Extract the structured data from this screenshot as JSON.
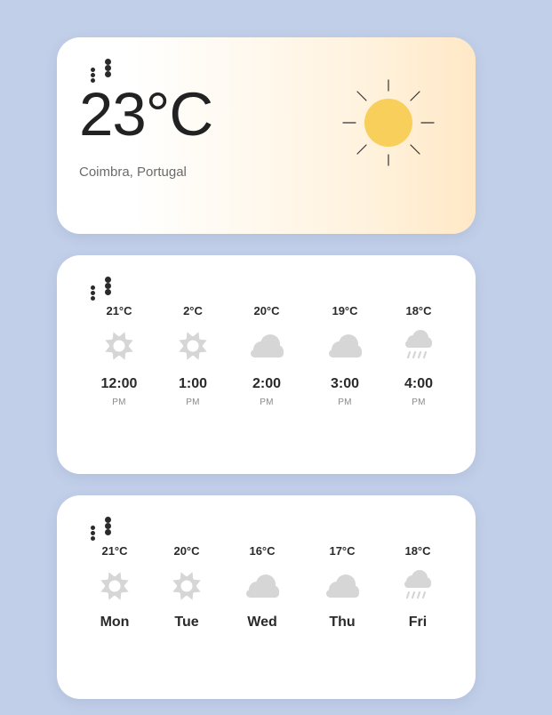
{
  "current": {
    "temperature": "23°C",
    "location": "Coimbra, Portugal",
    "icon": "sun-icon",
    "sun_color": "#f9cf5b"
  },
  "hourly": [
    {
      "temp": "21°C",
      "icon": "sun-icon",
      "time": "12:00",
      "ampm": "PM"
    },
    {
      "temp": "2°C",
      "icon": "sun-icon",
      "time": "1:00",
      "ampm": "PM"
    },
    {
      "temp": "20°C",
      "icon": "cloud-icon",
      "time": "2:00",
      "ampm": "PM"
    },
    {
      "temp": "19°C",
      "icon": "cloud-icon",
      "time": "3:00",
      "ampm": "PM"
    },
    {
      "temp": "18°C",
      "icon": "rain-cloud-icon",
      "time": "4:00",
      "ampm": "PM"
    }
  ],
  "daily": [
    {
      "temp": "21°C",
      "icon": "sun-icon",
      "day": "Mon"
    },
    {
      "temp": "20°C",
      "icon": "sun-icon",
      "day": "Tue"
    },
    {
      "temp": "16°C",
      "icon": "cloud-icon",
      "day": "Wed"
    },
    {
      "temp": "17°C",
      "icon": "cloud-icon",
      "day": "Thu"
    },
    {
      "temp": "18°C",
      "icon": "rain-cloud-icon",
      "day": "Fri"
    }
  ],
  "colors": {
    "background": "#c2cfe9",
    "icon_gray": "#d6d6d6"
  }
}
